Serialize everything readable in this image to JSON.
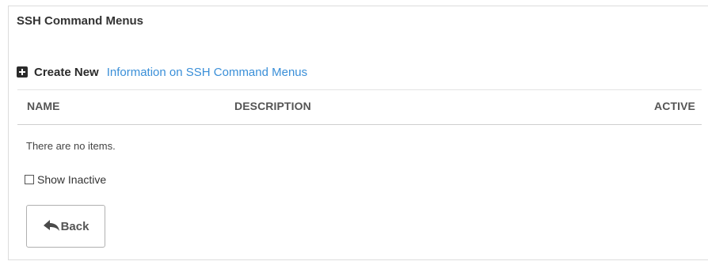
{
  "page": {
    "title": "SSH Command Menus"
  },
  "actions": {
    "create_new_label": "Create New",
    "info_link_label": "Information on SSH Command Menus"
  },
  "table": {
    "columns": [
      "NAME",
      "DESCRIPTION",
      "ACTIVE"
    ],
    "rows": [],
    "empty_text": "There are no items."
  },
  "filters": {
    "show_inactive_label": "Show Inactive",
    "show_inactive_checked": false
  },
  "footer": {
    "back_label": "Back"
  },
  "icons": {
    "create": "plus-square-icon",
    "back": "reply-arrow-icon",
    "show_inactive": "checkbox-icon"
  },
  "colors": {
    "link": "#3a8fd8",
    "heading": "#333333",
    "muted_header": "#555555"
  }
}
